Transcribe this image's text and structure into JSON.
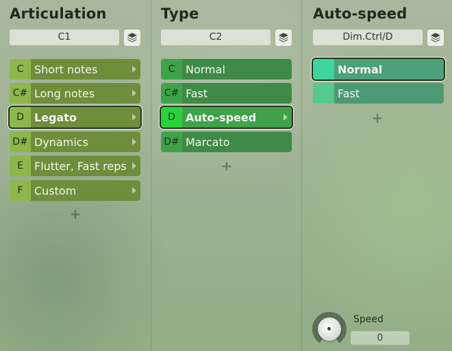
{
  "articulation": {
    "title": "Articulation",
    "selector_value": "C1",
    "layers_icon": "layers-icon",
    "items": [
      {
        "key": "C",
        "label": "Short notes"
      },
      {
        "key": "C#",
        "label": "Long notes"
      },
      {
        "key": "D",
        "label": "Legato",
        "selected": true
      },
      {
        "key": "D#",
        "label": "Dynamics"
      },
      {
        "key": "E",
        "label": "Flutter, Fast reps"
      },
      {
        "key": "F",
        "label": "Custom"
      }
    ],
    "add_label": "+"
  },
  "type": {
    "title": "Type",
    "selector_value": "C2",
    "layers_icon": "layers-icon",
    "items": [
      {
        "key": "C",
        "label": "Normal"
      },
      {
        "key": "C#",
        "label": "Fast"
      },
      {
        "key": "D",
        "label": "Auto-speed",
        "selected": true
      },
      {
        "key": "D#",
        "label": "Marcato"
      }
    ],
    "add_label": "+"
  },
  "auto_speed": {
    "title": "Auto-speed",
    "selector_value": "Dim.Ctrl/D",
    "layers_icon": "layers-icon",
    "items": [
      {
        "label": "Normal",
        "selected": true
      },
      {
        "label": "Fast"
      }
    ],
    "add_label": "+",
    "speed_label": "Speed",
    "speed_value": "0"
  },
  "colors": {
    "articulation_key": "#8fb64c",
    "type_key_selected": "#27d23e",
    "autospeed_key": "#3ed69a"
  }
}
